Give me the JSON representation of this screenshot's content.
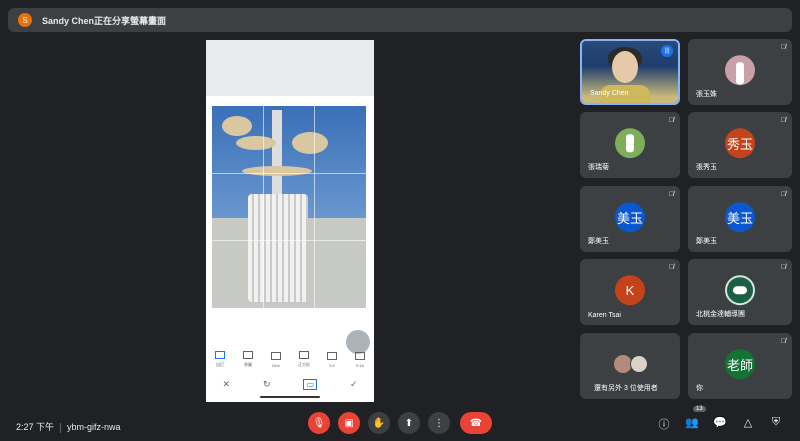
{
  "banner": {
    "avatar_letter": "S",
    "text": "Sandy Chen正在分享螢幕畫面"
  },
  "phone": {
    "tools": [
      {
        "label": "自訂"
      },
      {
        "label": "原圖"
      },
      {
        "label": "DHv"
      },
      {
        "label": "正方形"
      },
      {
        "label": "3:4"
      },
      {
        "label": "9:16"
      }
    ]
  },
  "participants": [
    {
      "name": "Sandy Chen",
      "speaking": true
    },
    {
      "name": "張玉姝"
    },
    {
      "name": "張瑞菊"
    },
    {
      "name": "張秀玉",
      "avatar_text": "秀玉",
      "color": "#c5431b"
    },
    {
      "name": "鄭美玉",
      "avatar_text": "美玉",
      "color": "#0b57d0"
    },
    {
      "name": "鄭美玉",
      "avatar_text": "美玉",
      "color": "#0b57d0"
    },
    {
      "name": "Karen Tsai",
      "avatar_text": "K",
      "color": "#c5431b"
    },
    {
      "name": "北桃金達輔導團"
    },
    {
      "name": "還有另外 3 位使用者"
    },
    {
      "name": "你",
      "avatar_text": "老師",
      "color": "#137333"
    }
  ],
  "bottom": {
    "time": "2:27 下午",
    "meeting_code": "ybm-gifz-nwa",
    "participant_count": "13"
  },
  "colors": {
    "background": "#202124",
    "tile": "#3c4043",
    "red": "#ea4335",
    "accent": "#8ab4f8"
  }
}
